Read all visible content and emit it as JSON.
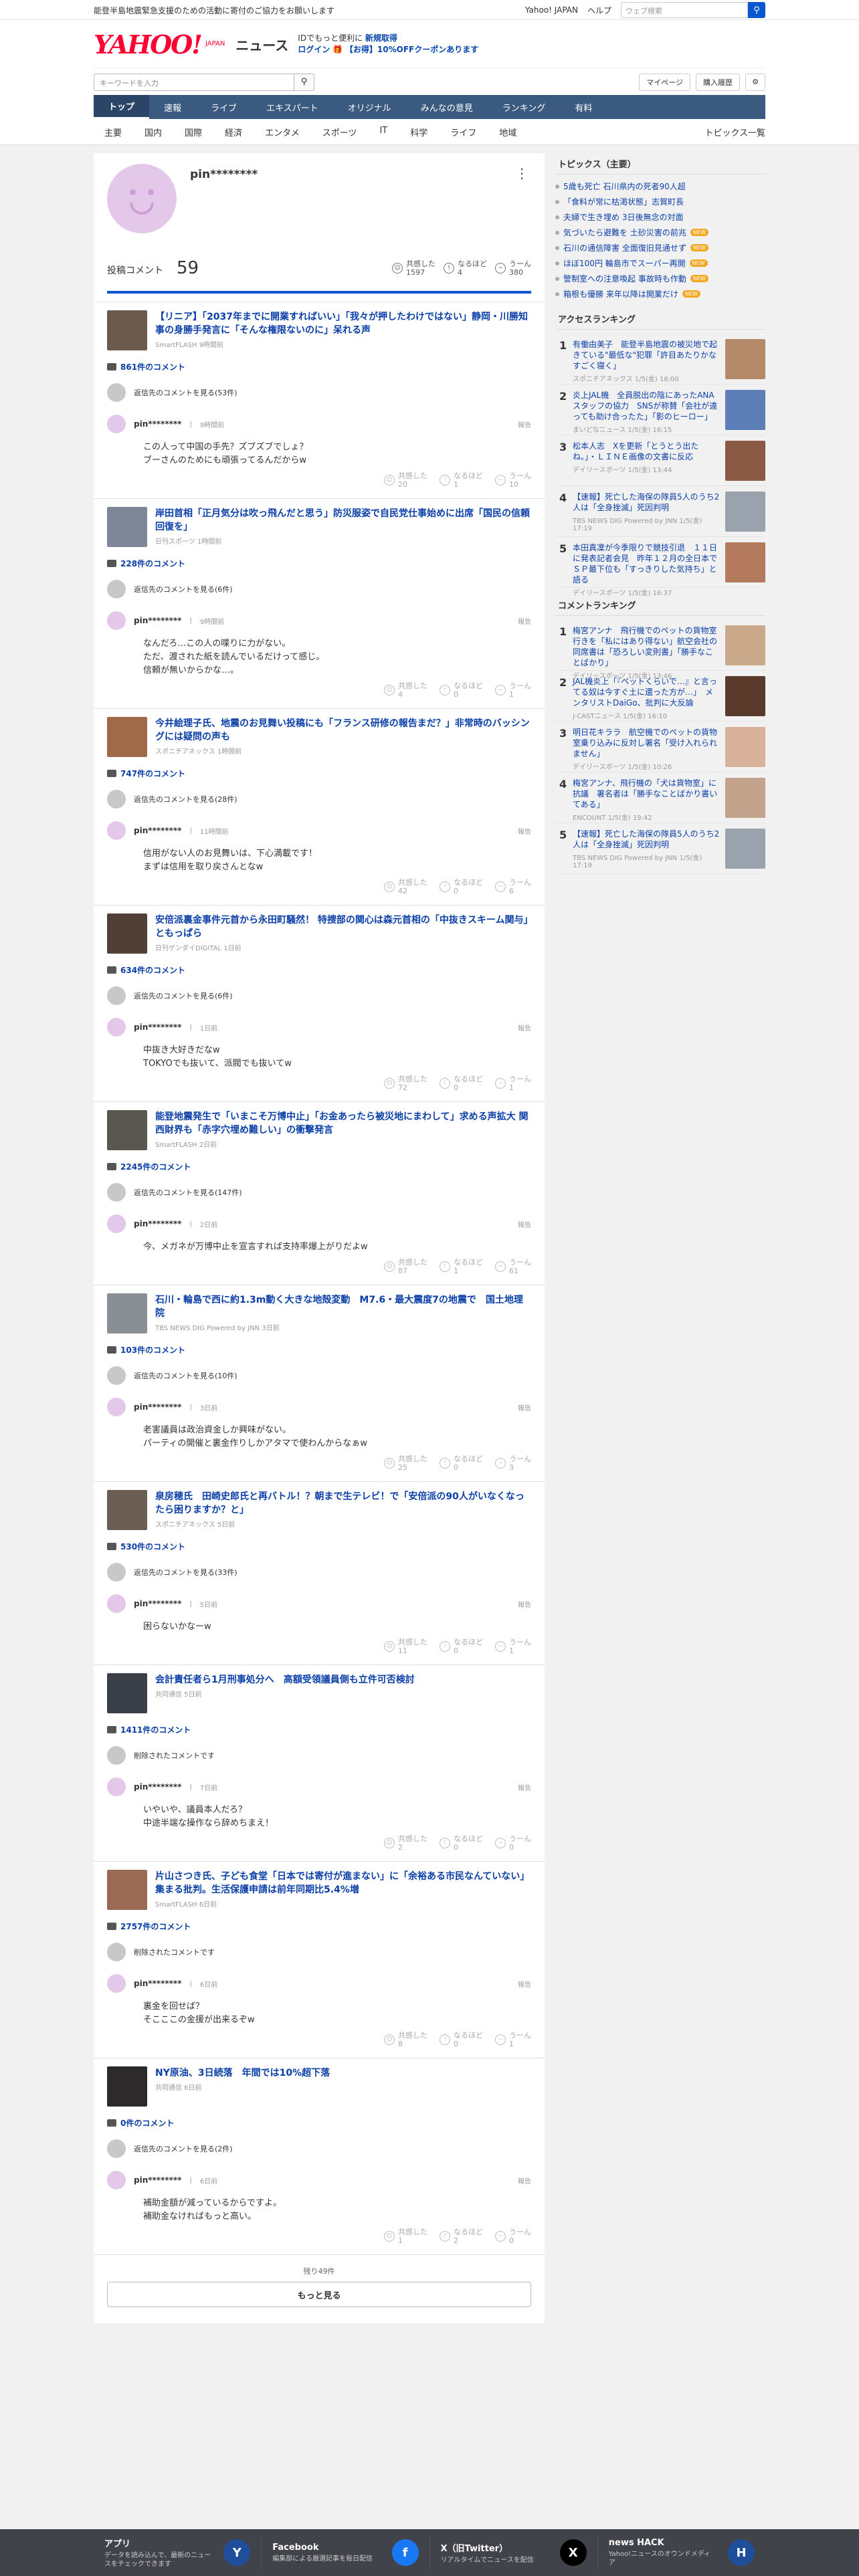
{
  "topbar": {
    "notice": "能登半島地震緊急支援のための活動に寄付のご協力をお願いします",
    "links": [
      "Yahoo! JAPAN",
      "ヘルプ"
    ],
    "search_placeholder": "ウェブ検索"
  },
  "header": {
    "logo": "YAHOO!",
    "logo_sub1": "JAPAN",
    "section": "ニュース",
    "promo_line1": "IDでもっと便利に",
    "promo_new": "新規取得",
    "promo_login": "ログイン",
    "promo_coupon": "【お得】10%OFFクーポンあります"
  },
  "search": {
    "placeholder": "キーワードを入力",
    "mypage": "マイページ",
    "history": "購入履歴"
  },
  "nav": {
    "tabs": [
      "トップ",
      "速報",
      "ライブ",
      "エキスパート",
      "オリジナル",
      "みんなの意見",
      "ランキング",
      "有料"
    ],
    "cats": [
      "主要",
      "国内",
      "国際",
      "経済",
      "エンタメ",
      "スポーツ",
      "IT",
      "科学",
      "ライフ",
      "地域"
    ],
    "all_topics": "トピックス一覧"
  },
  "profile": {
    "name": "pin********",
    "posts_label": "投稿コメント",
    "posts_count": "59",
    "reacts": [
      {
        "label": "共感した",
        "value": "1597"
      },
      {
        "label": "なるほど",
        "value": "4"
      },
      {
        "label": "うーん",
        "value": "380"
      }
    ]
  },
  "articles": [
    {
      "title": "【リニア】「2037年までに開業すればいい」「我々が押したわけではない」静岡・川勝知事の身勝手発言に「そんな権限ないのに」呆れる声",
      "source": "SmartFLASH 9時間前",
      "count": "861件のコメント",
      "other": "返信先のコメントを見る(53件)",
      "time": "9時間前",
      "text": "この人って中国の手先？ズブズブでしょ？\nブーさんのためにも頑張ってるんだからw",
      "r": [
        "20",
        "1",
        "10"
      ],
      "thumb": "#6b5a4e"
    },
    {
      "title": "岸田首相「正月気分は吹っ飛んだと思う」防災服姿で自民党仕事始めに出席「国民の信頼回復を」",
      "source": "日刊スポーツ 1時間前",
      "count": "228件のコメント",
      "other": "返信先のコメントを見る(6件)",
      "time": "9時間前",
      "text": "なんだろ…この人の喋りに力がない。\nただ、渡された紙を読んでいるだけって感じ。\n信頼が無いからかな…。",
      "r": [
        "4",
        "0",
        "1"
      ],
      "thumb": "#7d8798"
    },
    {
      "title": "今井絵理子氏、地震のお見舞い投稿にも「フランス研修の報告まだ？」非常時のバッシングには疑問の声も",
      "source": "スポニチアネックス 1時間前",
      "count": "747件のコメント",
      "other": "返信先のコメントを見る(28件)",
      "time": "11時間前",
      "text": "信用がない人のお見舞いは、下心満載です！\nまずは信用を取り戻さんとなw",
      "r": [
        "42",
        "0",
        "6"
      ],
      "thumb": "#a06a4a"
    },
    {
      "title": "安倍派裏金事件元首から永田町騒然！ 特捜部の関心は森元首相の「中抜きスキーム関与」ともっぱら",
      "source": "日刊ゲンダイDIGITAL 1日前",
      "count": "634件のコメント",
      "other": "返信先のコメントを見る(6件)",
      "time": "1日前",
      "text": "中抜き大好きだなw\nTOKYOでも抜いて、派閥でも抜いてw",
      "r": [
        "72",
        "0",
        "1"
      ],
      "thumb": "#4f3f36"
    },
    {
      "title": "能登地震発生で「いまこそ万博中止」「お金あったら被災地にまわして」求める声拡大 関西財界も「赤字穴埋め難しい」の衝撃発言",
      "source": "SmartFLASH 2日前",
      "count": "2245件のコメント",
      "other": "返信先のコメントを見る(147件)",
      "time": "2日前",
      "text": "今、メガネが万博中止を宣言すれば支持率爆上がりだよw",
      "r": [
        "87",
        "1",
        "61"
      ],
      "thumb": "#5a5650"
    },
    {
      "title": "石川・輪島で西に約1.3m動く大きな地殻変動　M7.6・最大震度7の地震で　国土地理院",
      "source": "TBS NEWS DIG Powered by JNN 3日前",
      "count": "103件のコメント",
      "other": "返信先のコメントを見る(10件)",
      "time": "3日前",
      "text": "老害議員は政治資金しか興味がない。\nパーティの開催と裏金作りしかアタマで使わんからなぁw",
      "r": [
        "25",
        "0",
        "3"
      ],
      "thumb": "#8a8f96"
    },
    {
      "title": "泉房穂氏　田崎史郎氏と再バトル！？朝まで生テレビ！で「安倍派の90人がいなくなったら困りますか？と」",
      "source": "スポニチアネックス 5日前",
      "count": "530件のコメント",
      "other": "返信先のコメントを見る(33件)",
      "time": "5日前",
      "text": "困らないかなーw",
      "r": [
        "11",
        "0",
        "1"
      ],
      "thumb": "#6c5e55"
    },
    {
      "title": "会計責任者ら1月刑事処分へ　高額受領議員側も立件可否検討",
      "source": "共同通信 5日前",
      "count": "1411件のコメント",
      "other": "削除されたコメントです",
      "time": "7日前",
      "text": "いやいや、議員本人だろ？\n中途半端な操作なら辞めちまえ！",
      "r": [
        "2",
        "0",
        "0"
      ],
      "thumb": "#3b3f48"
    },
    {
      "title": "片山さつき氏、子ども食堂「日本では寄付が進まない」に「余裕ある市民なんていない」集まる批判。生活保護申請は前年同期比5.4%増",
      "source": "SmartFLASH 6日前",
      "count": "2757件のコメント",
      "other": "削除されたコメントです",
      "time": "6日前",
      "text": "裏金を回せば？\nそこここの金援が出来るぞw",
      "r": [
        "8",
        "0",
        "1"
      ],
      "thumb": "#9a6b52"
    },
    {
      "title": "NY原油、3日続落　年間では10%超下落",
      "source": "共同通信 6日前",
      "count": "0件のコメント",
      "other": "返信先のコメントを見る(2件)",
      "time": "6日前",
      "text": "補助金額が減っているからですよ。\n補助金なければもっと高い。",
      "r": [
        "1",
        "2",
        "0"
      ],
      "thumb": "#2c2a2a"
    }
  ],
  "more": {
    "remain": "残り49件",
    "button": "もっと見る"
  },
  "report_label": "報告",
  "own_name": "pin********",
  "react_labels": [
    "共感した",
    "なるほど",
    "うーん"
  ],
  "sidebar": {
    "topics_title": "トピックス（主要）",
    "topics": [
      {
        "t": "5歳も死亡 石川県内の死者90人超",
        "badge": ""
      },
      {
        "t": "「食料が常に枯渇状態」志賀町長",
        "badge": ""
      },
      {
        "t": "夫婦で生き埋め 3日後無念の対面",
        "badge": ""
      },
      {
        "t": "気づいたら避難を 土砂災害の前兆",
        "badge": "NEW"
      },
      {
        "t": "石川の通信障害 全面復旧見通せず",
        "badge": "NEW"
      },
      {
        "t": "ほぼ100円 輪島市でスーパー再開",
        "badge": "NEW"
      },
      {
        "t": "警制室への注意喚起 事故時も作動",
        "badge": "NEW"
      },
      {
        "t": "箱根も優勝 来年以降は開業だけ",
        "badge": "NEW"
      }
    ],
    "access_title": "アクセスランキング",
    "access": [
      {
        "t": "有働由美子　能登半島地震の被災地で起きている\"最低な\"犯罪「許目あたりかなすごく寝く」",
        "s": "スポニチアネックス 1/5(金) 16:00",
        "c": "#b58a6a"
      },
      {
        "t": "炎上JAL機　全員脱出の陰にあったANAスタッフの協力　SNSが称賛「会社が違っても助け合ったた」「影のヒーロー」",
        "s": "まいどなニュース 1/5(金) 16:15",
        "c": "#5c7fb8"
      },
      {
        "t": "松本人志　Xを更新「とうとう出たね。」・ＬＩＮＥ画像の文書に反応",
        "s": "デイリースポーツ 1/5(金) 13:44",
        "c": "#8a5a44"
      },
      {
        "t": "【速報】死亡した海保の隊員5人のうち2人は「全身挫滅」死因判明",
        "s": "TBS NEWS DIG Powered by JNN 1/5(金) 17:19",
        "c": "#9aa3ad"
      },
      {
        "t": "本田真凜が今季限りで競技引退　１１日に発表記者会見　昨年１２月の全日本でＳＰ最下位も「すっきりした気持ち」と語る",
        "s": "デイリースポーツ 1/5(金) 16:37",
        "c": "#b37a5e"
      }
    ],
    "comment_title": "コメントランキング",
    "comment": [
      {
        "t": "梅宮アンナ　飛行機でのペットの貨物室行きを「私にはあり得ない」航空会社の同席書は「恐ろしい変則書」「勝手なことばかり」",
        "s": "デイリースポーツ 1/5(金) 13:46",
        "c": "#c9a98a"
      },
      {
        "t": "JAL機炎上「『ペットくらいで…』と言ってる奴は今すぐ土に還った方が…」　メンタリストDaiGo、批判に大反論",
        "s": "J-CASTニュース 1/5(金) 16:10",
        "c": "#5a3a2a"
      },
      {
        "t": "明日花キララ　航空機でのペットの貨物室乗り込みに反対し署名「受け入れられません」",
        "s": "デイリースポーツ 1/5(金) 10:26",
        "c": "#d8b29a"
      },
      {
        "t": "梅宮アンナ、飛行機の「犬は貨物室」に抗議　署名者は「勝手なことばかり書いてある」",
        "s": "ENCOUNT 1/5(金) 19:42",
        "c": "#c4a38c"
      },
      {
        "t": "【速報】死亡した海保の隊員5人のうち2人は「全身挫滅」死因判明",
        "s": "TBS NEWS DIG Powered by JNN 1/5(金) 17:19",
        "c": "#9aa3ad"
      }
    ]
  },
  "footer": [
    {
      "title": "アプリ",
      "desc": "データを読み込んで、最新のニュースをチェックできます",
      "icon": "app-icon",
      "color": "#1f4e9a"
    },
    {
      "title": "Facebook",
      "desc": "編集部による厳選記事を毎日配信",
      "icon": "facebook-icon",
      "color": "#1877f2"
    },
    {
      "title": "X（旧Twitter）",
      "desc": "リアルタイムでニュースを配信",
      "icon": "x-icon",
      "color": "#000000"
    },
    {
      "title": "news HACK",
      "desc": "Yahoo!ニュースのオウンドメディア",
      "icon": "newshack-icon",
      "color": "#1f4e9a"
    }
  ]
}
